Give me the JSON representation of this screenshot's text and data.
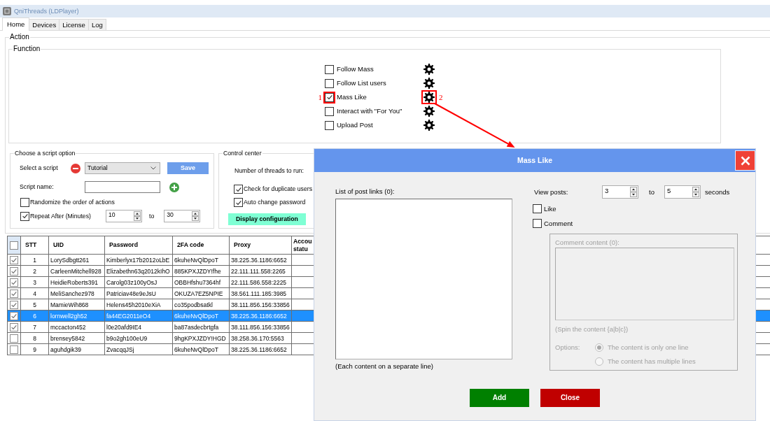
{
  "window": {
    "title": "QniThreads (LDPlayer)"
  },
  "tabs": [
    {
      "label": "Home",
      "selected": true
    },
    {
      "label": "Devices",
      "selected": false
    },
    {
      "label": "License",
      "selected": false
    },
    {
      "label": "Log",
      "selected": false
    }
  ],
  "action": {
    "title": "Action",
    "function": {
      "title": "Function",
      "items": [
        {
          "label": "Follow Mass",
          "checked": false
        },
        {
          "label": "Follow List users",
          "checked": false
        },
        {
          "label": "Mass Like",
          "checked": true,
          "checkbox_callout": "1",
          "settings_callout": "2"
        },
        {
          "label": "Interact with \"For You\"",
          "checked": false
        },
        {
          "label": "Upload Post",
          "checked": false
        }
      ]
    },
    "script_option": {
      "title": "Choose a script option",
      "select_label": "Select a script",
      "script": "Tutorial",
      "save_button": "Save",
      "name_label": "Script name:",
      "randomize": {
        "label": "Randomize the order of actions",
        "checked": false
      },
      "repeat": {
        "label": "Repeat After (Minutes)",
        "checked": true,
        "from": "10",
        "range_word": "to",
        "to": "30"
      }
    },
    "control_center": {
      "title": "Control center",
      "threads_label": "Number of threads to run:",
      "options": [
        {
          "label": "Check for duplicate users",
          "checked": true
        },
        {
          "label": "Auto change password",
          "checked": true
        }
      ],
      "button": "Display configuration"
    }
  },
  "table": {
    "header_checked": false,
    "columns": [
      "STT",
      "UID",
      "Password",
      "2FA code",
      "Proxy",
      "Accou statu"
    ],
    "rows": [
      {
        "checked": true,
        "selected": false,
        "cells": [
          "1",
          "LorySdbgtt261",
          "Kimberlyx17b2012oLbE",
          "6kuheNvQlDpoT",
          "38.225.36.1186:6652"
        ]
      },
      {
        "checked": true,
        "selected": false,
        "cells": [
          "2",
          "CarleenMitchell928",
          "Elizabethn63q2012kIhO",
          "885KPXJZDY!fhe",
          "22.111.111.558:2265"
        ]
      },
      {
        "checked": true,
        "selected": false,
        "cells": [
          "3",
          "HeidieRoberts391",
          "Carolg03z100yOsJ",
          "OBBHfshu7364hf",
          "22.111.586.558:2225"
        ]
      },
      {
        "checked": true,
        "selected": false,
        "cells": [
          "4",
          "MeliSanchez978",
          "Patriciav48e9eJsU",
          "OKUZA7EZ5NPIE",
          "38.561.111.185:3985"
        ]
      },
      {
        "checked": true,
        "selected": false,
        "cells": [
          "5",
          "MamieWih868",
          "Helens45h2010eXiA",
          "co35podbsatkl",
          "38.111.856.156:33856"
        ]
      },
      {
        "checked": true,
        "selected": true,
        "cells": [
          "6",
          "lornwell2gh52",
          "fa44EG2011eO4",
          "6kuheNvQlDpoT",
          "38.225.36.1186:6652"
        ]
      },
      {
        "checked": true,
        "selected": false,
        "cells": [
          "7",
          "mccacton452",
          "l0e20afd9IE4",
          "ba87asdecbrtgfa",
          "38.111.856.156:33856"
        ]
      },
      {
        "checked": false,
        "selected": false,
        "cells": [
          "8",
          "brensey5842",
          "b9o2gh100eU9",
          "9hgKPXJZDY!HGD",
          "38.258.36.170:5563"
        ]
      },
      {
        "checked": false,
        "selected": false,
        "cells": [
          "9",
          "aguhdgik39",
          "ZvacqqJSj",
          "6kuheNvQlDpoT",
          "38.225.36.1186:6652"
        ]
      }
    ]
  },
  "dialog": {
    "title": "Mass Like",
    "links_label": "List of post links (0):",
    "links_note": "(Each content on a separate line)",
    "view_label": "View posts:",
    "view_from": "3",
    "range_word": "to",
    "view_to": "5",
    "unit": "seconds",
    "toggles": [
      {
        "label": "Like",
        "checked": false
      },
      {
        "label": "Comment",
        "checked": false
      }
    ],
    "comment": {
      "disabled": true,
      "label": "Comment content (0):",
      "note": "(Spin the content {a|b|c})",
      "options_label": "Options:",
      "modes": [
        {
          "label": "The content is only one line",
          "selected": true
        },
        {
          "label": "The content has multiple lines",
          "selected": false
        }
      ]
    },
    "buttons": [
      {
        "label": "Add",
        "kind": "confirm"
      },
      {
        "label": "Close",
        "kind": "cancel"
      }
    ]
  }
}
